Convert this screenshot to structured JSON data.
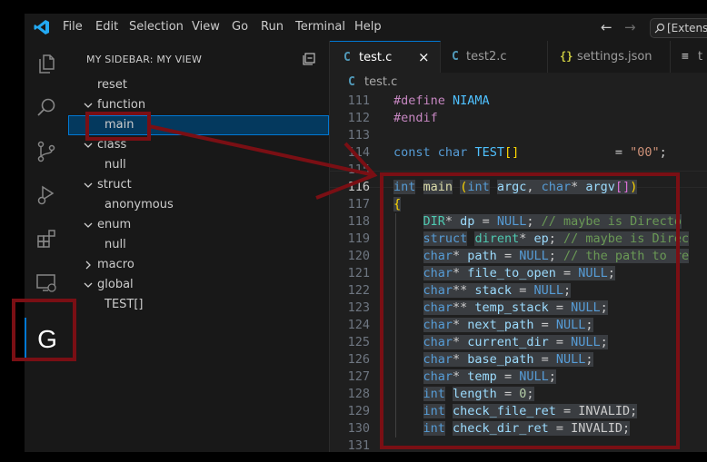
{
  "menubar": {
    "items": [
      "File",
      "Edit",
      "Selection",
      "View",
      "Go",
      "Run",
      "Terminal",
      "Help"
    ],
    "search_text": "[Extens"
  },
  "activity_bar": {
    "icons": [
      "explorer-icon",
      "search-icon",
      "source-control-icon",
      "run-debug-icon",
      "extensions-icon",
      "remote-explorer-icon",
      "custom-g-icon"
    ],
    "g_label": "G"
  },
  "sidebar": {
    "title": "MY SIDEBAR: MY VIEW",
    "tree": [
      {
        "label": "reset",
        "indent": 0,
        "expanded": null
      },
      {
        "label": "function",
        "indent": 0,
        "expanded": true
      },
      {
        "label": "main",
        "indent": 1,
        "expanded": null,
        "selected": true
      },
      {
        "label": "class",
        "indent": 0,
        "expanded": true
      },
      {
        "label": "null",
        "indent": 1,
        "expanded": null
      },
      {
        "label": "struct",
        "indent": 0,
        "expanded": true
      },
      {
        "label": "anonymous",
        "indent": 1,
        "expanded": null
      },
      {
        "label": "enum",
        "indent": 0,
        "expanded": true
      },
      {
        "label": "null",
        "indent": 1,
        "expanded": null
      },
      {
        "label": "macro",
        "indent": 0,
        "expanded": false
      },
      {
        "label": "global",
        "indent": 0,
        "expanded": true
      },
      {
        "label": "TEST[]",
        "indent": 1,
        "expanded": null
      }
    ]
  },
  "tabs": [
    {
      "icon": "C",
      "label": "test.c",
      "active": true,
      "closable": true
    },
    {
      "icon": "C",
      "label": "test2.c",
      "active": false
    },
    {
      "icon": "{}",
      "label": "settings.json",
      "active": false
    },
    {
      "icon": "≡",
      "label": "t",
      "active": false
    }
  ],
  "breadcrumb": {
    "icon": "C",
    "label": "test.c"
  },
  "code": {
    "current_line": "116",
    "lines": [
      {
        "n": "111",
        "tokens": [
          [
            "pp",
            "#define"
          ],
          [
            "",
            " "
          ],
          [
            "const",
            "NIAMA"
          ]
        ]
      },
      {
        "n": "112",
        "tokens": [
          [
            "pp",
            "#endif"
          ]
        ]
      },
      {
        "n": "113",
        "tokens": []
      },
      {
        "n": "114",
        "tokens": [
          [
            "kw",
            "const"
          ],
          [
            "",
            " "
          ],
          [
            "kw",
            "char"
          ],
          [
            "",
            " "
          ],
          [
            "const",
            "TEST"
          ],
          [
            "br2",
            "[]"
          ],
          [
            "",
            "             = "
          ],
          [
            "str",
            "\"00\""
          ],
          [
            "",
            ";"
          ]
        ]
      },
      {
        "n": "115",
        "tokens": []
      },
      {
        "n": "116",
        "tokens": [
          [
            "kw",
            "int"
          ],
          [
            "",
            " "
          ],
          [
            "fn",
            "main"
          ],
          [
            "",
            " "
          ],
          [
            "br2",
            "("
          ],
          [
            "kw",
            "int"
          ],
          [
            "",
            " "
          ],
          [
            "var",
            "argc"
          ],
          [
            "",
            ", "
          ],
          [
            "kw",
            "char"
          ],
          [
            "",
            "* "
          ],
          [
            "var",
            "argv"
          ],
          [
            "br",
            "[]"
          ],
          [
            "br2",
            ")"
          ]
        ]
      },
      {
        "n": "117",
        "tokens": [
          [
            "br2",
            "{"
          ]
        ]
      },
      {
        "n": "118",
        "tokens": [
          [
            "",
            "    "
          ],
          [
            "ty",
            "DIR"
          ],
          [
            "",
            "* "
          ],
          [
            "var",
            "dp"
          ],
          [
            "",
            " = "
          ],
          [
            "kw",
            "NULL"
          ],
          [
            "",
            "; "
          ],
          [
            "cm",
            "// maybe is Directo"
          ]
        ]
      },
      {
        "n": "119",
        "tokens": [
          [
            "",
            "    "
          ],
          [
            "kw",
            "struct"
          ],
          [
            "",
            " "
          ],
          [
            "ty",
            "dirent"
          ],
          [
            "",
            "* "
          ],
          [
            "var",
            "ep"
          ],
          [
            "",
            "; "
          ],
          [
            "cm",
            "// maybe is Direc"
          ]
        ]
      },
      {
        "n": "120",
        "tokens": [
          [
            "",
            "    "
          ],
          [
            "kw",
            "char"
          ],
          [
            "",
            "* "
          ],
          [
            "var",
            "path"
          ],
          [
            "",
            " = "
          ],
          [
            "kw",
            "NULL"
          ],
          [
            "",
            "; "
          ],
          [
            "cm",
            "// the path to re"
          ]
        ]
      },
      {
        "n": "121",
        "tokens": [
          [
            "",
            "    "
          ],
          [
            "kw",
            "char"
          ],
          [
            "",
            "* "
          ],
          [
            "var",
            "file_to_open"
          ],
          [
            "",
            " = "
          ],
          [
            "kw",
            "NULL"
          ],
          [
            "",
            ";"
          ]
        ]
      },
      {
        "n": "122",
        "tokens": [
          [
            "",
            "    "
          ],
          [
            "kw",
            "char"
          ],
          [
            "",
            "** "
          ],
          [
            "var",
            "stack"
          ],
          [
            "",
            " = "
          ],
          [
            "kw",
            "NULL"
          ],
          [
            "",
            ";"
          ]
        ]
      },
      {
        "n": "123",
        "tokens": [
          [
            "",
            "    "
          ],
          [
            "kw",
            "char"
          ],
          [
            "",
            "** "
          ],
          [
            "var",
            "temp_stack"
          ],
          [
            "",
            " = "
          ],
          [
            "kw",
            "NULL"
          ],
          [
            "",
            ";"
          ]
        ]
      },
      {
        "n": "124",
        "tokens": [
          [
            "",
            "    "
          ],
          [
            "kw",
            "char"
          ],
          [
            "",
            "* "
          ],
          [
            "var",
            "next_path"
          ],
          [
            "",
            " = "
          ],
          [
            "kw",
            "NULL"
          ],
          [
            "",
            ";"
          ]
        ]
      },
      {
        "n": "125",
        "tokens": [
          [
            "",
            "    "
          ],
          [
            "kw",
            "char"
          ],
          [
            "",
            "* "
          ],
          [
            "var",
            "current_dir"
          ],
          [
            "",
            " = "
          ],
          [
            "kw",
            "NULL"
          ],
          [
            "",
            ";"
          ]
        ]
      },
      {
        "n": "126",
        "tokens": [
          [
            "",
            "    "
          ],
          [
            "kw",
            "char"
          ],
          [
            "",
            "* "
          ],
          [
            "var",
            "base_path"
          ],
          [
            "",
            " = "
          ],
          [
            "kw",
            "NULL"
          ],
          [
            "",
            ";"
          ]
        ]
      },
      {
        "n": "127",
        "tokens": [
          [
            "",
            "    "
          ],
          [
            "kw",
            "char"
          ],
          [
            "",
            "* "
          ],
          [
            "var",
            "temp"
          ],
          [
            "",
            " = "
          ],
          [
            "kw",
            "NULL"
          ],
          [
            "",
            ";"
          ]
        ]
      },
      {
        "n": "128",
        "tokens": [
          [
            "",
            "    "
          ],
          [
            "kw",
            "int"
          ],
          [
            "",
            " "
          ],
          [
            "var",
            "length"
          ],
          [
            "",
            " = "
          ],
          [
            "num",
            "0"
          ],
          [
            "",
            ";"
          ]
        ]
      },
      {
        "n": "129",
        "tokens": [
          [
            "",
            "    "
          ],
          [
            "kw",
            "int"
          ],
          [
            "",
            " "
          ],
          [
            "var",
            "check_file_ret"
          ],
          [
            "",
            " = "
          ],
          [
            "",
            "INVALID"
          ],
          [
            "",
            ";"
          ]
        ]
      },
      {
        "n": "130",
        "tokens": [
          [
            "",
            "    "
          ],
          [
            "kw",
            "int"
          ],
          [
            "",
            " "
          ],
          [
            "var",
            "check_dir_ret"
          ],
          [
            "",
            " = "
          ],
          [
            "",
            "INVALID"
          ],
          [
            "",
            ";"
          ]
        ]
      },
      {
        "n": "131",
        "tokens": []
      }
    ]
  }
}
